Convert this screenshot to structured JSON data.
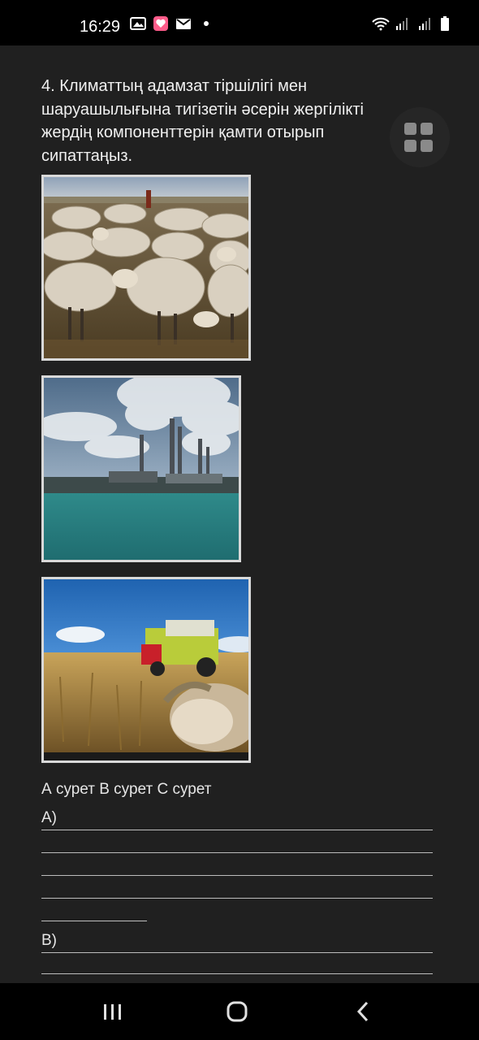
{
  "status_bar": {
    "time": "16:29",
    "left_icons": [
      "image-icon",
      "heart-app-icon",
      "mail-icon",
      "dot-icon"
    ],
    "right_icons": [
      "wifi-icon",
      "signal-1-icon",
      "signal-2-icon",
      "battery-icon"
    ]
  },
  "question": {
    "text": "4. Климаттың адамзат тіршілігі мен шаруашылығына тигізетін әсерін жергілікті жердің компоненттерін қамти отырып сипаттаңыз."
  },
  "images": [
    {
      "name": "sheep-flock-photo"
    },
    {
      "name": "industrial-plant-photo"
    },
    {
      "name": "wheat-harvester-photo"
    }
  ],
  "caption": "А сурет В сурет С сурет",
  "answers": [
    {
      "label": "А)"
    },
    {
      "label": ""
    },
    {
      "label": ""
    },
    {
      "label": ""
    },
    {
      "label": ""
    },
    {
      "label": "В)"
    },
    {
      "label": ""
    }
  ],
  "colors": {
    "background": "#202020",
    "status_bar": "#000000",
    "text": "#f0f0f0"
  }
}
